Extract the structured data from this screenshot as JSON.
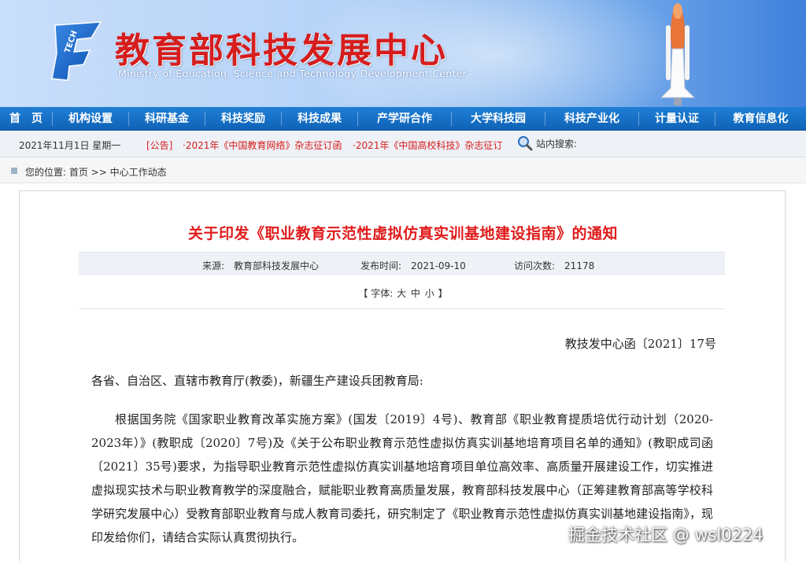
{
  "header": {
    "title": "教育部科技发展中心",
    "subtitle": "Ministry of Education, Science and Technology Development Center",
    "logo_text": "TECH"
  },
  "nav": {
    "items": [
      "首　页",
      "机构设置",
      "科研基金",
      "科技奖励",
      "科技成果",
      "产学研合作",
      "大学科技园",
      "科技产业化",
      "计量认证",
      "教育信息化"
    ]
  },
  "infobar": {
    "date": "2021年11月1日 星期一",
    "notice_label": "[公告]",
    "notices": [
      "·2021年《中国教育网络》杂志征订函",
      "·2021年《中国高校科技》杂志征订"
    ],
    "search_label": "站内搜索:"
  },
  "breadcrumb": {
    "text": "您的位置: 首页 >> 中心工作动态"
  },
  "article": {
    "title": "关于印发《职业教育示范性虚拟仿真实训基地建设指南》的通知",
    "source": "来源:　教育部科技发展中心",
    "publish_time": "发布时间:　2021-09-10",
    "visits": "访问次数:　21178",
    "fontsize_open": "【 字体:",
    "fontsize_large": "大",
    "fontsize_medium": "中",
    "fontsize_small": "小",
    "fontsize_close": "】",
    "doc_number": "教技发中心函〔2021〕17号",
    "greeting": "各省、自治区、直辖市教育厅(教委)，新疆生产建设兵团教育局:",
    "paragraph": "根据国务院《国家职业教育改革实施方案》(国发〔2019〕4号)、教育部《职业教育提质培优行动计划（2020-2023年）》(教职成〔2020〕7号)及《关于公布职业教育示范性虚拟仿真实训基地培育项目名单的通知》(教职成司函〔2021〕35号)要求，为指导职业教育示范性虚拟仿真实训基地培育项目单位高效率、高质量开展建设工作，切实推进虚拟现实技术与职业教育教学的深度融合，赋能职业教育高质量发展，教育部科技发展中心（正筹建教育部高等学校科学研究发展中心）受教育部职业教育与成人教育司委托，研究制定了《职业教育示范性虚拟仿真实训基地建设指南》，现印发给你们，请结合实际认真贯彻执行。"
  },
  "watermark": "掘金技术社区 @ wsl0224",
  "colors": {
    "brand_red": "#d61d1d",
    "nav_blue": "#1170c8",
    "title_red": "#e01b1b"
  }
}
